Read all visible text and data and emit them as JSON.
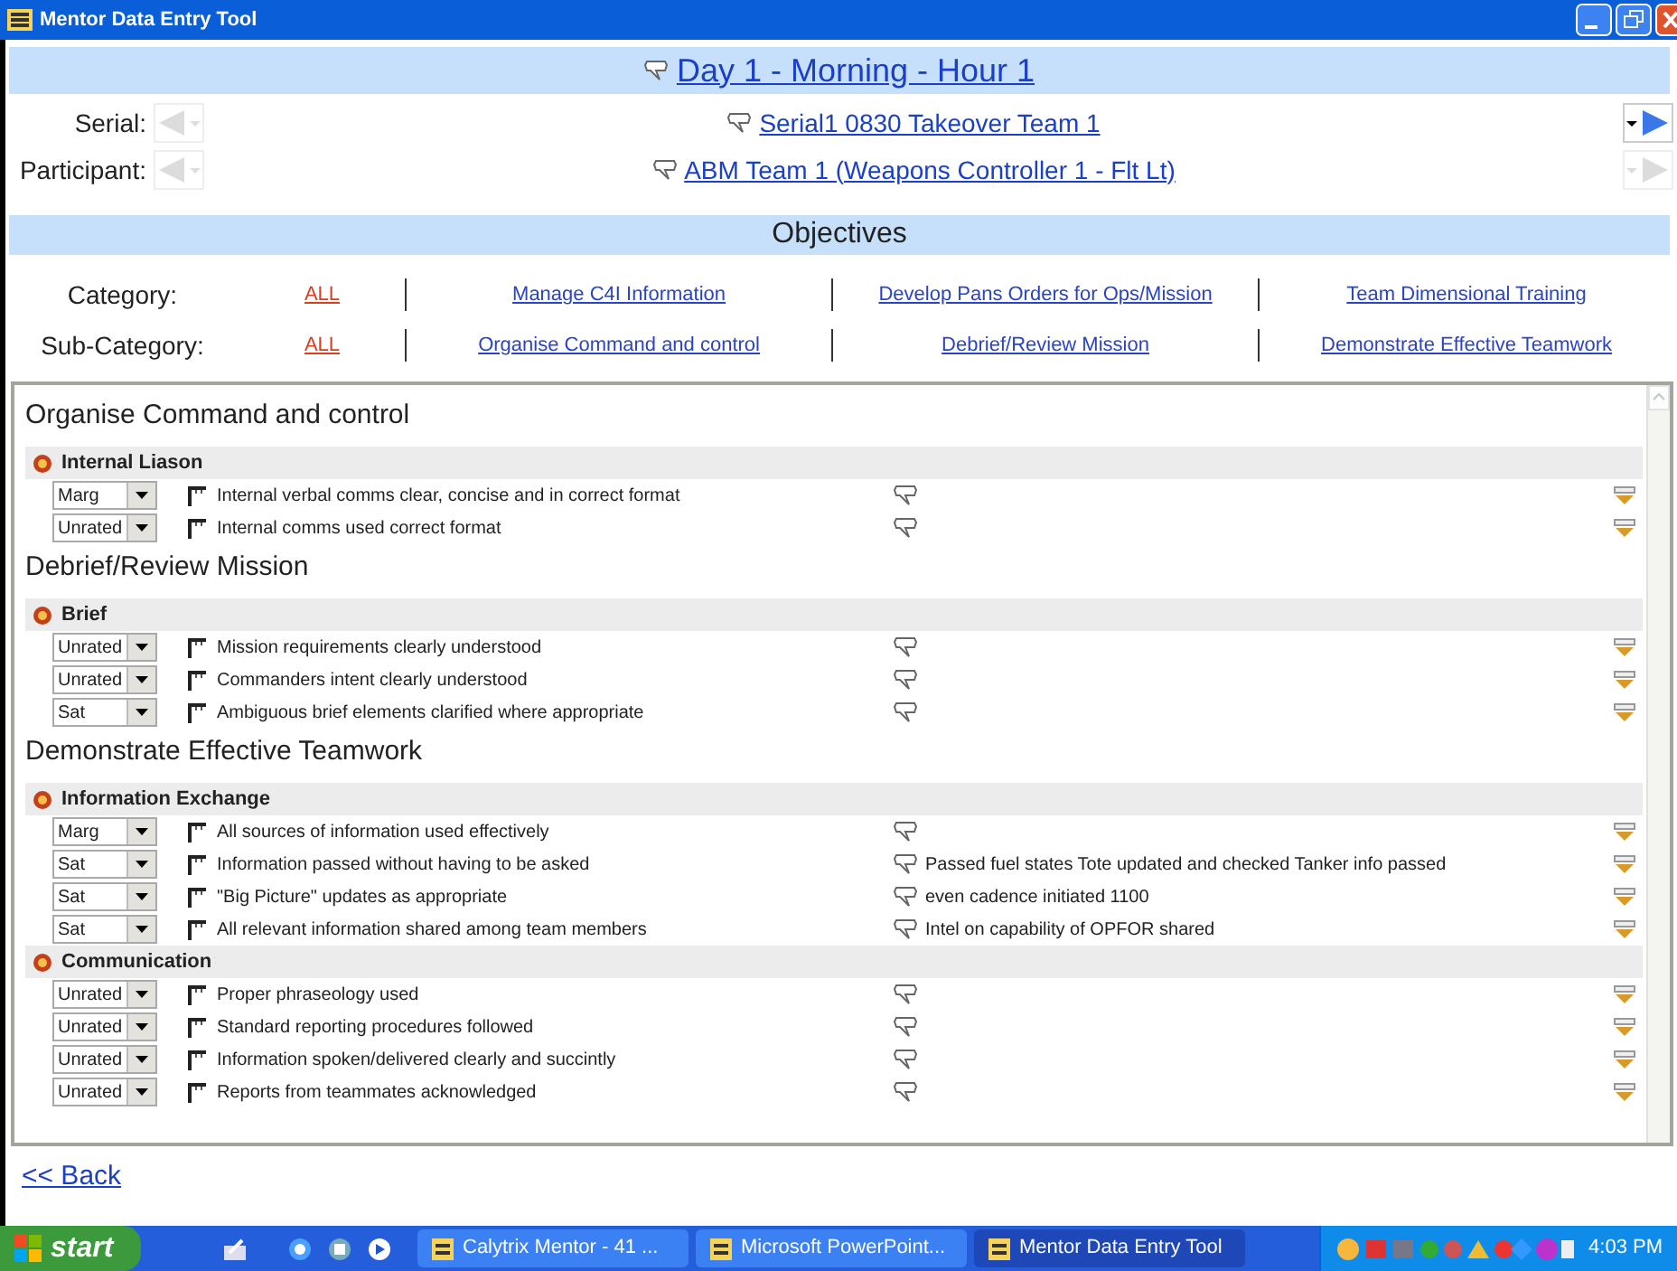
{
  "window": {
    "title": "Mentor Data Entry Tool"
  },
  "header": {
    "title": "Day 1 - Morning - Hour 1"
  },
  "navigation": [
    {
      "label": "Serial:",
      "value": "Serial1 0830 Takeover Team 1",
      "prev_disabled": true,
      "next_disabled": false
    },
    {
      "label": "Participant:",
      "value": "ABM Team 1 (Weapons Controller 1 - Flt Lt)",
      "prev_disabled": true,
      "next_disabled": true
    }
  ],
  "objectives_title": "Objectives",
  "filters": [
    {
      "label": "Category:",
      "options": [
        {
          "label": "ALL",
          "selected": true
        },
        {
          "label": "Manage C4I Information",
          "selected": false
        },
        {
          "label": "Develop Pans  Orders for Ops/Mission",
          "selected": false
        },
        {
          "label": "Team Dimensional Training",
          "selected": false
        }
      ]
    },
    {
      "label": "Sub-Category:",
      "options": [
        {
          "label": "ALL",
          "selected": true
        },
        {
          "label": "Organise Command and control",
          "selected": false
        },
        {
          "label": "Debrief/Review Mission",
          "selected": false
        },
        {
          "label": "Demonstrate Effective Teamwork",
          "selected": false
        }
      ]
    }
  ],
  "sections": [
    {
      "title": "Organise Command and control",
      "groups": [
        {
          "title": "Internal Liason",
          "items": [
            {
              "rating": "Marg",
              "text": "Internal verbal comms clear, concise and in correct format"
            },
            {
              "rating": "Unrated",
              "text": "Internal comms used correct format"
            }
          ]
        }
      ]
    },
    {
      "title": "Debrief/Review Mission",
      "groups": [
        {
          "title": "Brief",
          "items": [
            {
              "rating": "Unrated",
              "text": "Mission requirements clearly understood"
            },
            {
              "rating": "Unrated",
              "text": "Commanders intent clearly understood"
            },
            {
              "rating": "Sat",
              "text": "Ambiguous brief elements clarified where appropriate"
            }
          ]
        }
      ]
    },
    {
      "title": "Demonstrate Effective Teamwork",
      "groups": [
        {
          "title": "Information Exchange",
          "items": [
            {
              "rating": "Marg",
              "text": "All sources of information used effectively"
            },
            {
              "rating": "Sat",
              "text": "Information passed without having to be asked",
              "comment": "Passed fuel states Tote updated and checked Tanker info passed"
            },
            {
              "rating": "Sat",
              "text": "\"Big Picture\" updates as appropriate",
              "comment": "even cadence initiated 1100"
            },
            {
              "rating": "Sat",
              "text": "All relevant information shared among team members",
              "comment": "Intel on capability of OPFOR shared"
            }
          ]
        },
        {
          "title": "Communication",
          "items": [
            {
              "rating": "Unrated",
              "text": "Proper phraseology used"
            },
            {
              "rating": "Unrated",
              "text": "Standard reporting procedures followed"
            },
            {
              "rating": "Unrated",
              "text": "Information spoken/delivered clearly and succintly"
            },
            {
              "rating": "Unrated",
              "text": "Reports from teammates acknowledged"
            }
          ]
        }
      ]
    }
  ],
  "back_link": "<< Back",
  "taskbar": {
    "start": "start",
    "tasks": [
      {
        "label": "Calytrix Mentor - 41 ...",
        "selected": false
      },
      {
        "label": "Microsoft PowerPoint...",
        "selected": false
      },
      {
        "label": "Mentor Data Entry Tool",
        "selected": true
      }
    ],
    "clock": "4:03 PM"
  }
}
